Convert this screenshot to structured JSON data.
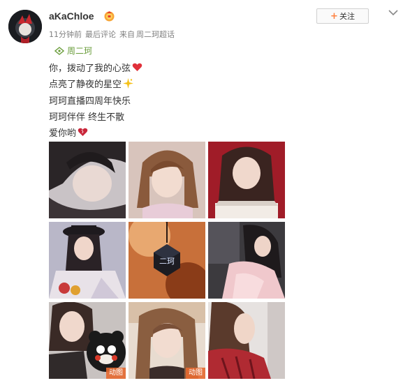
{
  "post": {
    "username": "aKaChloe",
    "time": "11分钟前",
    "last_comment": "最后评论",
    "source_prefix": "来自",
    "source": "周二珂超话",
    "follow_label": "关注",
    "topic": "周二珂",
    "lines": [
      "你，拨动了我的心弦",
      "点亮了静夜的星空",
      "珂珂直播四周年快乐",
      "珂珂伴伴 终生不散",
      "爱你哟"
    ],
    "photo_tags": [
      "动图",
      "动图"
    ],
    "pendant_text": "二珂"
  },
  "icons": {
    "avatar": "avatar",
    "badge": "vip-badge-icon",
    "topic": "super-topic-icon",
    "more": "chevron-down-icon",
    "heart": "heart-emoji",
    "sparkle": "sparkle-emoji"
  },
  "colors": {
    "accent_orange": "#ff8140",
    "topic_green": "#6a9d3b",
    "meta_gray": "#808080",
    "gif_tag": "#e66930"
  }
}
